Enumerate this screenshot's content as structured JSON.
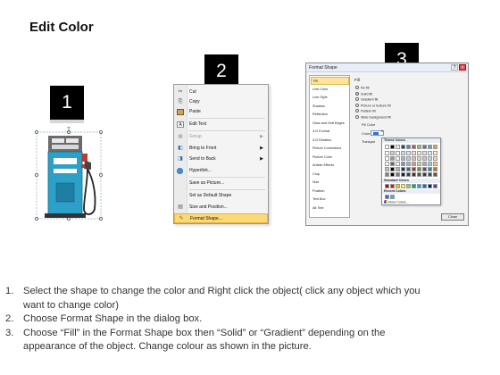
{
  "title": "Edit Color",
  "steps": [
    "1",
    "2",
    "3"
  ],
  "context_menu": {
    "items": [
      {
        "label": "Cut",
        "icon": "scissors-icon",
        "glyph": "✂",
        "disabled": false,
        "submenu": false
      },
      {
        "label": "Copy",
        "icon": "copy-icon",
        "glyph": "⎘",
        "disabled": false,
        "submenu": false
      },
      {
        "label": "Paste",
        "icon": "paste-icon",
        "glyph": "📋",
        "disabled": false,
        "submenu": false
      },
      {
        "label": "Edit Text",
        "icon": "edit-text-icon",
        "glyph": "A",
        "disabled": false,
        "submenu": false
      },
      {
        "label": "Group",
        "icon": "group-icon",
        "glyph": "▣",
        "disabled": true,
        "submenu": true
      },
      {
        "label": "Bring to Front",
        "icon": "bring-to-front-icon",
        "glyph": "◧",
        "disabled": false,
        "submenu": true
      },
      {
        "label": "Send to Back",
        "icon": "send-to-back-icon",
        "glyph": "◨",
        "disabled": false,
        "submenu": true
      },
      {
        "label": "Hyperlink...",
        "icon": "hyperlink-icon",
        "glyph": "🌐",
        "disabled": false,
        "submenu": false
      },
      {
        "label": "Save as Picture...",
        "icon": "",
        "glyph": "",
        "disabled": false,
        "submenu": false
      },
      {
        "label": "Set as Default Shape",
        "icon": "",
        "glyph": "",
        "disabled": false,
        "submenu": false
      },
      {
        "label": "Size and Position...",
        "icon": "size-position-icon",
        "glyph": "▤",
        "disabled": false,
        "submenu": false
      },
      {
        "label": "Format Shape...",
        "icon": "format-shape-icon",
        "glyph": "✎",
        "disabled": false,
        "submenu": false,
        "highlighted": true
      }
    ]
  },
  "format_dialog": {
    "title": "Format Shape",
    "categories": [
      "Fill",
      "Line Color",
      "Line Style",
      "Shadow",
      "Reflection",
      "Glow and Soft Edges",
      "3-D Format",
      "3-D Rotation",
      "Picture Corrections",
      "Picture Color",
      "Artistic Effects",
      "Crop",
      "Size",
      "Position",
      "Text Box",
      "Alt Text"
    ],
    "selected_category": "Fill",
    "fill_heading": "Fill",
    "fill_options": [
      "No fill",
      "Solid fill",
      "Gradient fill",
      "Picture or texture fill",
      "Pattern fill",
      "Slide background fill"
    ],
    "selected_fill": "Solid fill",
    "fill_color_label": "Fill Color",
    "color_label": "Color:",
    "transparency_label": "Transpar",
    "palette": {
      "theme_heading": "Theme Colors",
      "standard_heading": "Standard Colors",
      "recent_heading": "Recent Colors",
      "more_colors": "More Colors...",
      "theme_top": [
        "#ffffff",
        "#000000",
        "#eeece1",
        "#1f497d",
        "#4f81bd",
        "#c0504d",
        "#9bbb59",
        "#8064a2",
        "#4bacc6",
        "#f79646"
      ],
      "standard": [
        "#c00000",
        "#ff0000",
        "#ffc000",
        "#ffff00",
        "#92d050",
        "#00b050",
        "#00b0f0",
        "#0070c0",
        "#002060",
        "#7030a0"
      ],
      "recent": [
        "#2673c8",
        "#4bacc6"
      ]
    },
    "close_label": "Close"
  },
  "instructions": [
    {
      "num": "1.",
      "lines": [
        "Select the shape to change the color and Right click the object( click any object which you",
        "want to change color)"
      ]
    },
    {
      "num": "2.",
      "lines": [
        "Choose Format Shape in the dialog box."
      ]
    },
    {
      "num": "3.",
      "lines": [
        "Choose “Fill” in the Format Shape box then “Solid” or “Gradient” depending on the",
        "appearance of the object. Change colour as shown in the picture."
      ]
    }
  ],
  "colors": {
    "pump_body": "#2da0c8",
    "pump_top": "#5a5a5a",
    "highlight": "#fbd878"
  }
}
